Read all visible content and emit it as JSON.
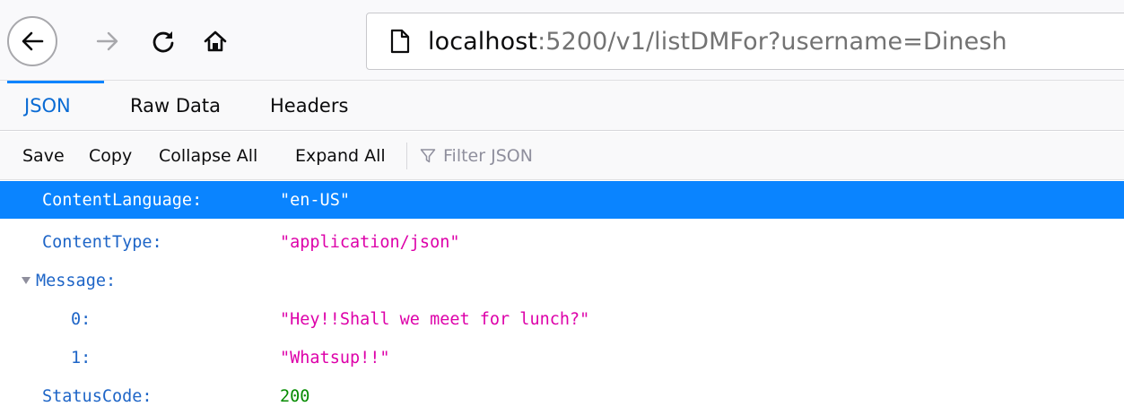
{
  "navbar": {
    "back_icon": "back-arrow-icon",
    "forward_icon": "forward-arrow-icon",
    "reload_icon": "reload-icon",
    "home_icon": "home-icon",
    "page_icon": "page-info-icon",
    "url_host": "localhost",
    "url_rest": ":5200/v1/listDMFor?username=Dinesh"
  },
  "tabs": {
    "json": "JSON",
    "raw": "Raw Data",
    "headers": "Headers"
  },
  "toolbar": {
    "save": "Save",
    "copy": "Copy",
    "collapse_all": "Collapse All",
    "expand_all": "Expand All",
    "filter_placeholder": "Filter JSON",
    "filter_icon": "filter-icon"
  },
  "tree": {
    "rows": [
      {
        "key": "ContentLanguage:",
        "value": "\"en-US\""
      },
      {
        "key": "ContentType:",
        "value": "\"application/json\""
      },
      {
        "key": "Message:",
        "value": ""
      },
      {
        "key": "0:",
        "value": "\"Hey!!Shall we meet for lunch?\""
      },
      {
        "key": "1:",
        "value": "\"Whatsup!!\""
      },
      {
        "key": "StatusCode:",
        "value": "200"
      }
    ]
  },
  "colors": {
    "selection": "#0a84ff",
    "key": "#1e65c7",
    "string": "#dd00a9",
    "number": "#058b00",
    "tab_accent": "#0a84ff"
  }
}
